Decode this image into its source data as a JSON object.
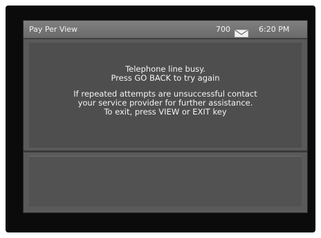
{
  "header": {
    "title": "Pay Per View",
    "channel": "700",
    "time": "6:20 PM",
    "mail_icon": "envelope-icon"
  },
  "message": {
    "line1": "Telephone line busy.",
    "line2": "Press GO BACK to try again",
    "line3": "If repeated attempts are unsuccessful contact",
    "line4": "your service provider for further assistance.",
    "line5": "To exit, press VIEW or EXIT key"
  },
  "colors": {
    "screen_bg": "#5a5a5a",
    "header_bg": "#7a7a7a",
    "text": "#f4f4f4"
  }
}
